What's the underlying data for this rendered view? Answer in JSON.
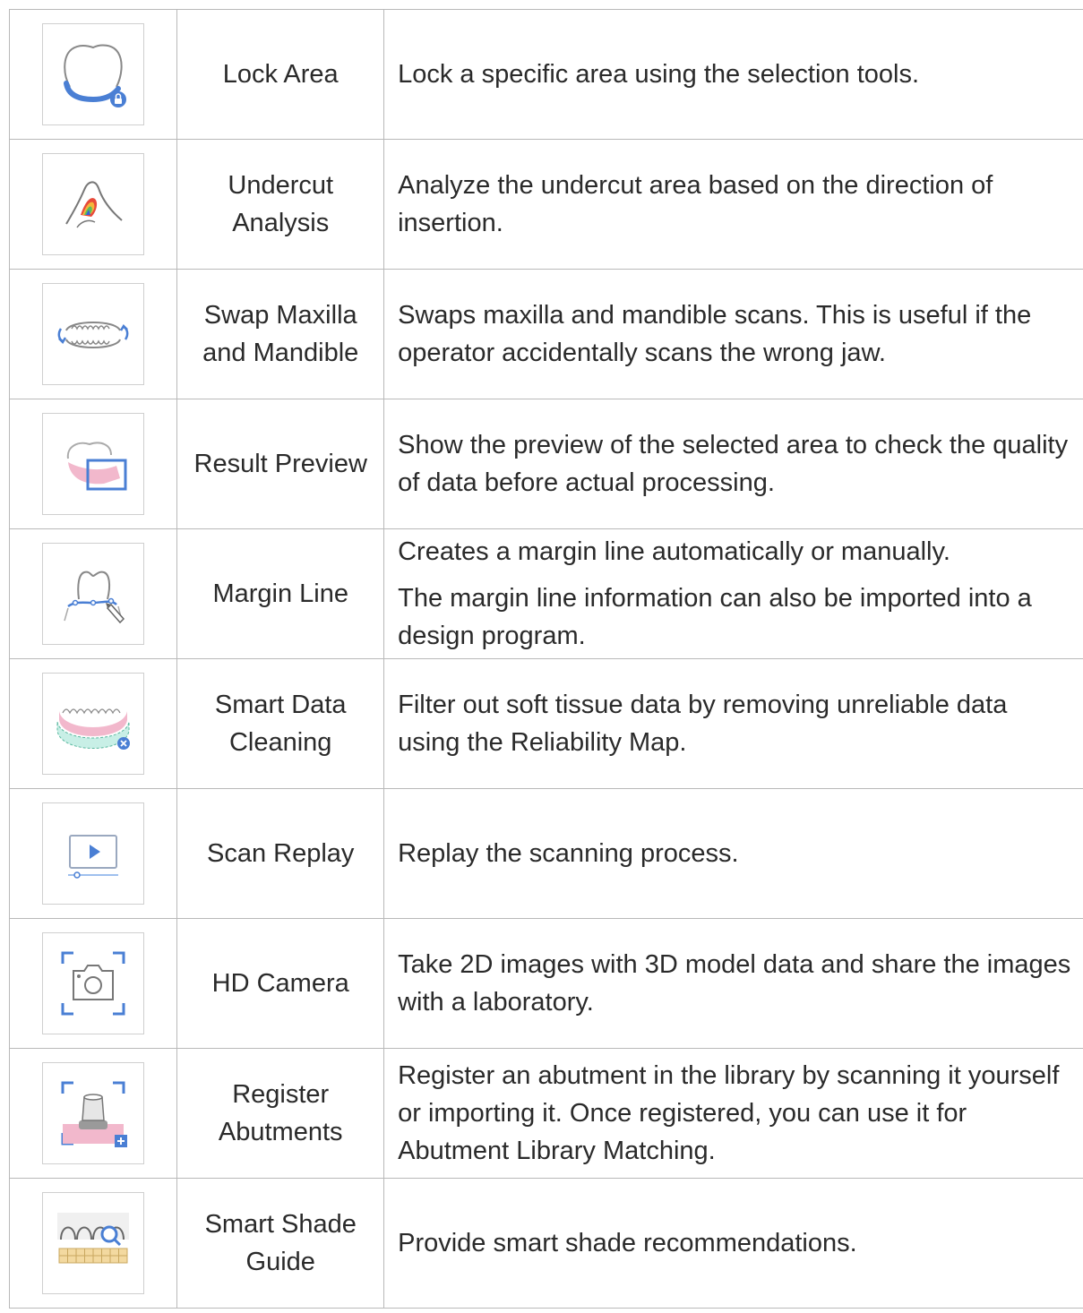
{
  "colors": {
    "border": "#b9b9b9",
    "accent_blue": "#4a7fd4",
    "pink": "#f2b8cc",
    "mint": "#c8efe6"
  },
  "rows": [
    {
      "icon": "lock-area-icon",
      "name": "Lock Area",
      "desc": [
        "Lock a specific area using the selection tools."
      ]
    },
    {
      "icon": "undercut-analysis-icon",
      "name": "Undercut Analysis",
      "desc": [
        "Analyze the undercut area based on the direction of insertion."
      ]
    },
    {
      "icon": "swap-jaws-icon",
      "name": "Swap Maxilla and Mandible",
      "desc": [
        "Swaps maxilla and mandible scans. This is useful if the operator accidentally scans the wrong jaw."
      ]
    },
    {
      "icon": "result-preview-icon",
      "name": "Result Preview",
      "desc": [
        "Show the preview of the selected area to check the quality of data before actual processing."
      ]
    },
    {
      "icon": "margin-line-icon",
      "name": "Margin Line",
      "desc": [
        "Creates a margin line automatically or manually.",
        "The margin line information can also be imported into a design program."
      ]
    },
    {
      "icon": "smart-data-cleaning-icon",
      "name": "Smart Data Cleaning",
      "desc": [
        "Filter out soft tissue data by removing unreliable data using the Reliability Map."
      ]
    },
    {
      "icon": "scan-replay-icon",
      "name": "Scan Replay",
      "desc": [
        "Replay the scanning process."
      ]
    },
    {
      "icon": "hd-camera-icon",
      "name": "HD Camera",
      "desc": [
        "Take 2D images with 3D model data and share the images with a laboratory."
      ]
    },
    {
      "icon": "register-abutments-icon",
      "name": "Register Abutments",
      "desc": [
        "Register an abutment in the library by scanning it yourself or importing it. Once registered, you can use it for Abutment Library Matching."
      ]
    },
    {
      "icon": "smart-shade-guide-icon",
      "name": "Smart Shade Guide",
      "desc": [
        "Provide smart shade recommendations."
      ]
    }
  ]
}
